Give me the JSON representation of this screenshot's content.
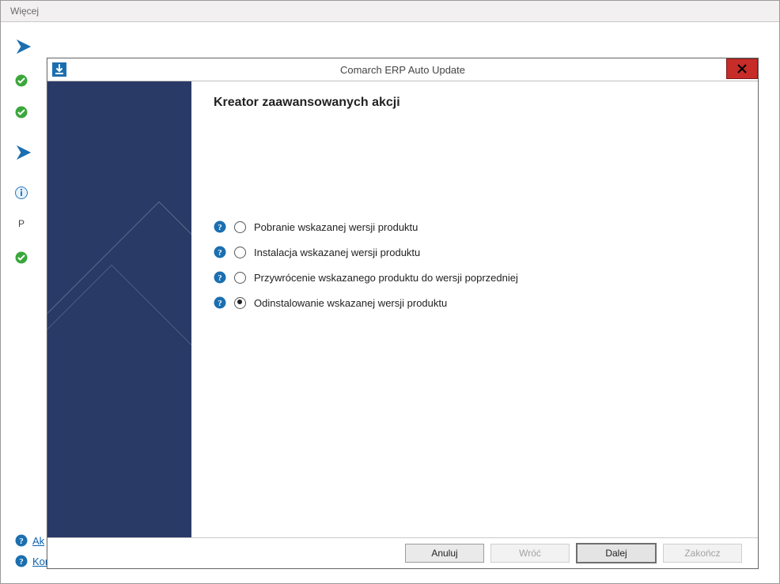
{
  "outer": {
    "title": "Więcej"
  },
  "background": {
    "label_stub": "P",
    "links": {
      "first_stub": "Ak",
      "config": "Konfiguracja"
    }
  },
  "dialog": {
    "title": "Comarch ERP Auto Update",
    "heading": "Kreator zaawansowanych akcji",
    "options": [
      {
        "label": "Pobranie wskazanej wersji produktu",
        "checked": false
      },
      {
        "label": "Instalacja wskazanej wersji produktu",
        "checked": false
      },
      {
        "label": "Przywrócenie wskazanego produktu do wersji poprzedniej",
        "checked": false
      },
      {
        "label": "Odinstalowanie wskazanej wersji produktu",
        "checked": true
      }
    ],
    "buttons": {
      "cancel": "Anuluj",
      "back": "Wróć",
      "next": "Dalej",
      "finish": "Zakończ"
    }
  }
}
